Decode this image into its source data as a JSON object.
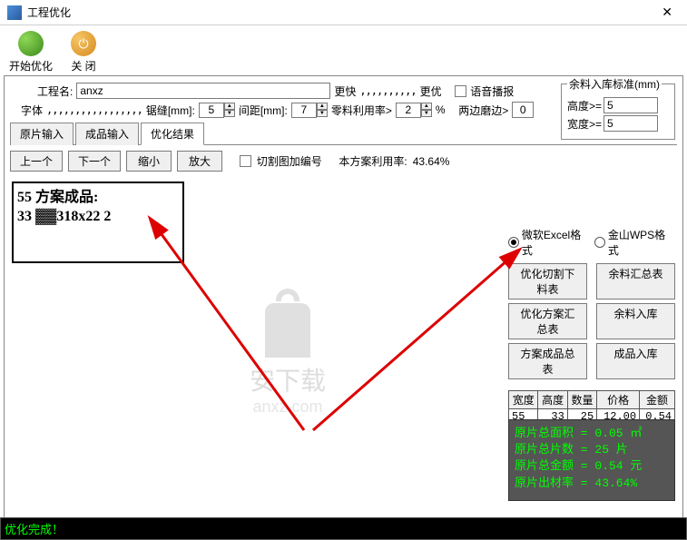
{
  "window": {
    "title": "工程优化",
    "close": "✕"
  },
  "toolbar": {
    "start_label": "开始优化",
    "close_label": "关 闭"
  },
  "project": {
    "name_label": "工程名:",
    "name_value": "anxz",
    "faster": "更快",
    "better": "更优",
    "voice_label": "语音播报"
  },
  "surplus": {
    "legend": "余料入库标准(mm)",
    "height_label": "高度>=",
    "height_value": "5",
    "width_label": "宽度>=",
    "width_value": "5"
  },
  "font_row": {
    "font_label": "字体",
    "saw_label": "锯缝[mm]:",
    "saw_value": "5",
    "gap_label": "间距[mm]:",
    "gap_value": "7",
    "scrap_label": "零料利用率>",
    "scrap_value": "2",
    "percent": "%",
    "edge_label": "两边磨边>",
    "edge_value": "0"
  },
  "tabs": {
    "t1": "原片输入",
    "t2": "成品输入",
    "t3": "优化结果"
  },
  "nav": {
    "prev": "上一个",
    "next": "下一个",
    "zoom_out": "缩小",
    "zoom_in": "放大",
    "numbering": "切割图加编号",
    "usage_label": "本方案利用率:",
    "usage_value": "43.64%"
  },
  "format": {
    "excel": "微软Excel格式",
    "wps": "金山WPS格式"
  },
  "buttons": {
    "cut_list": "优化切割下料表",
    "surplus_summary": "余料汇总表",
    "plan_summary": "优化方案汇总表",
    "surplus_in": "余料入库",
    "product_summary": "方案成品总表",
    "product_in": "成品入库"
  },
  "preview": {
    "line1": "55 方案成品:",
    "line2": "33 ▓▓318x22 2"
  },
  "table": {
    "headers": [
      "宽度",
      "高度",
      "数量",
      "价格",
      "金额"
    ],
    "row": [
      "55",
      "33",
      "25",
      "12.00",
      "0.54"
    ]
  },
  "stats": {
    "l1": "原片总面积 = 0.05 ㎡",
    "l2": "原片总片数 = 25 片",
    "l3": "原片总金额 = 0.54 元",
    "l4": "原片出材率 = 43.64%"
  },
  "status": "优化完成！",
  "watermark": {
    "name": "安下载",
    "url": "anxz.com"
  }
}
